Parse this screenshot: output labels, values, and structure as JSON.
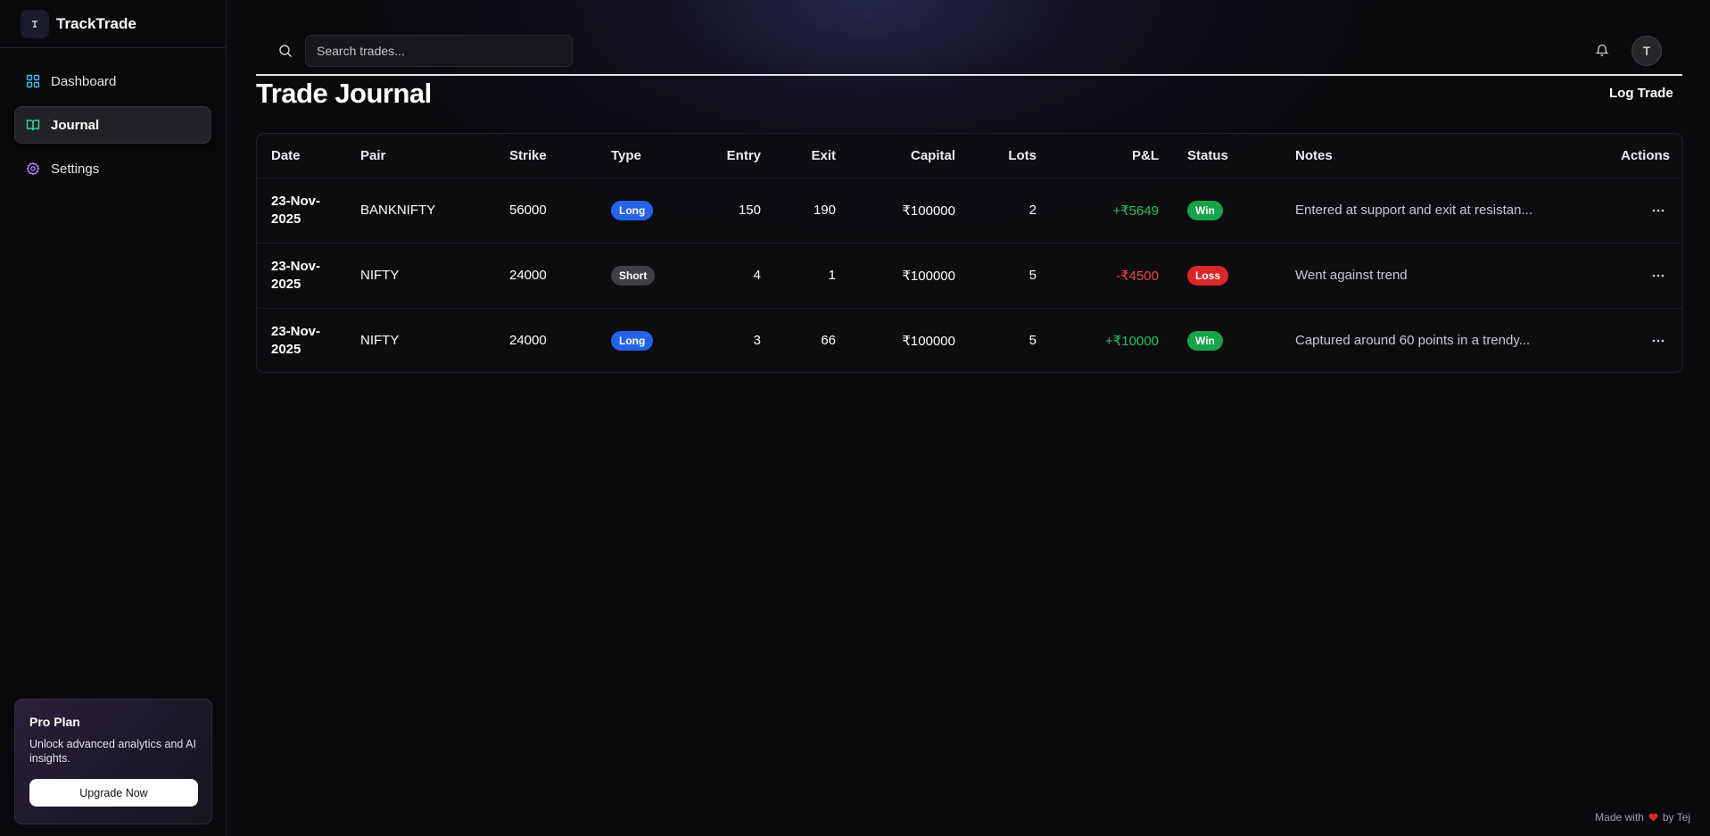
{
  "brand": {
    "name": "TrackTrade"
  },
  "sidebar": {
    "items": [
      {
        "label": "Dashboard",
        "icon": "layout-grid-icon",
        "color": "#38bdf8"
      },
      {
        "label": "Journal",
        "icon": "book-open-icon",
        "color": "#34d399",
        "active": true
      },
      {
        "label": "Settings",
        "icon": "gear-icon",
        "color": "#c084fc"
      }
    ],
    "pro": {
      "title": "Pro Plan",
      "description": "Unlock advanced analytics and AI insights.",
      "button": "Upgrade Now"
    }
  },
  "header": {
    "search_placeholder": "Search trades...",
    "avatar_initial": "T"
  },
  "page": {
    "title": "Trade Journal",
    "log_trade": "Log Trade"
  },
  "table": {
    "headers": [
      "Date",
      "Pair",
      "Strike",
      "Type",
      "Entry",
      "Exit",
      "Capital",
      "Lots",
      "P&L",
      "Status",
      "Notes",
      "Actions"
    ],
    "rows": [
      {
        "date1": "23-Nov-",
        "date2": "2025",
        "pair": "BANKNIFTY",
        "strike": "56000",
        "type": "Long",
        "entry": "150",
        "exit": "190",
        "capital": "₹100000",
        "lots": "2",
        "pnl": "+₹5649",
        "status": "Win",
        "notes": "Entered at support and exit at resistan..."
      },
      {
        "date1": "23-Nov-",
        "date2": "2025",
        "pair": "NIFTY",
        "strike": "24000",
        "type": "Short",
        "entry": "4",
        "exit": "1",
        "capital": "₹100000",
        "lots": "5",
        "pnl": "-₹4500",
        "status": "Loss",
        "notes": "Went against trend"
      },
      {
        "date1": "23-Nov-",
        "date2": "2025",
        "pair": "NIFTY",
        "strike": "24000",
        "type": "Long",
        "entry": "3",
        "exit": "66",
        "capital": "₹100000",
        "lots": "5",
        "pnl": "+₹10000",
        "status": "Win",
        "notes": "Captured around 60 points in a trendy..."
      }
    ]
  },
  "footer": {
    "before": "Made with",
    "after": "by Tej"
  }
}
